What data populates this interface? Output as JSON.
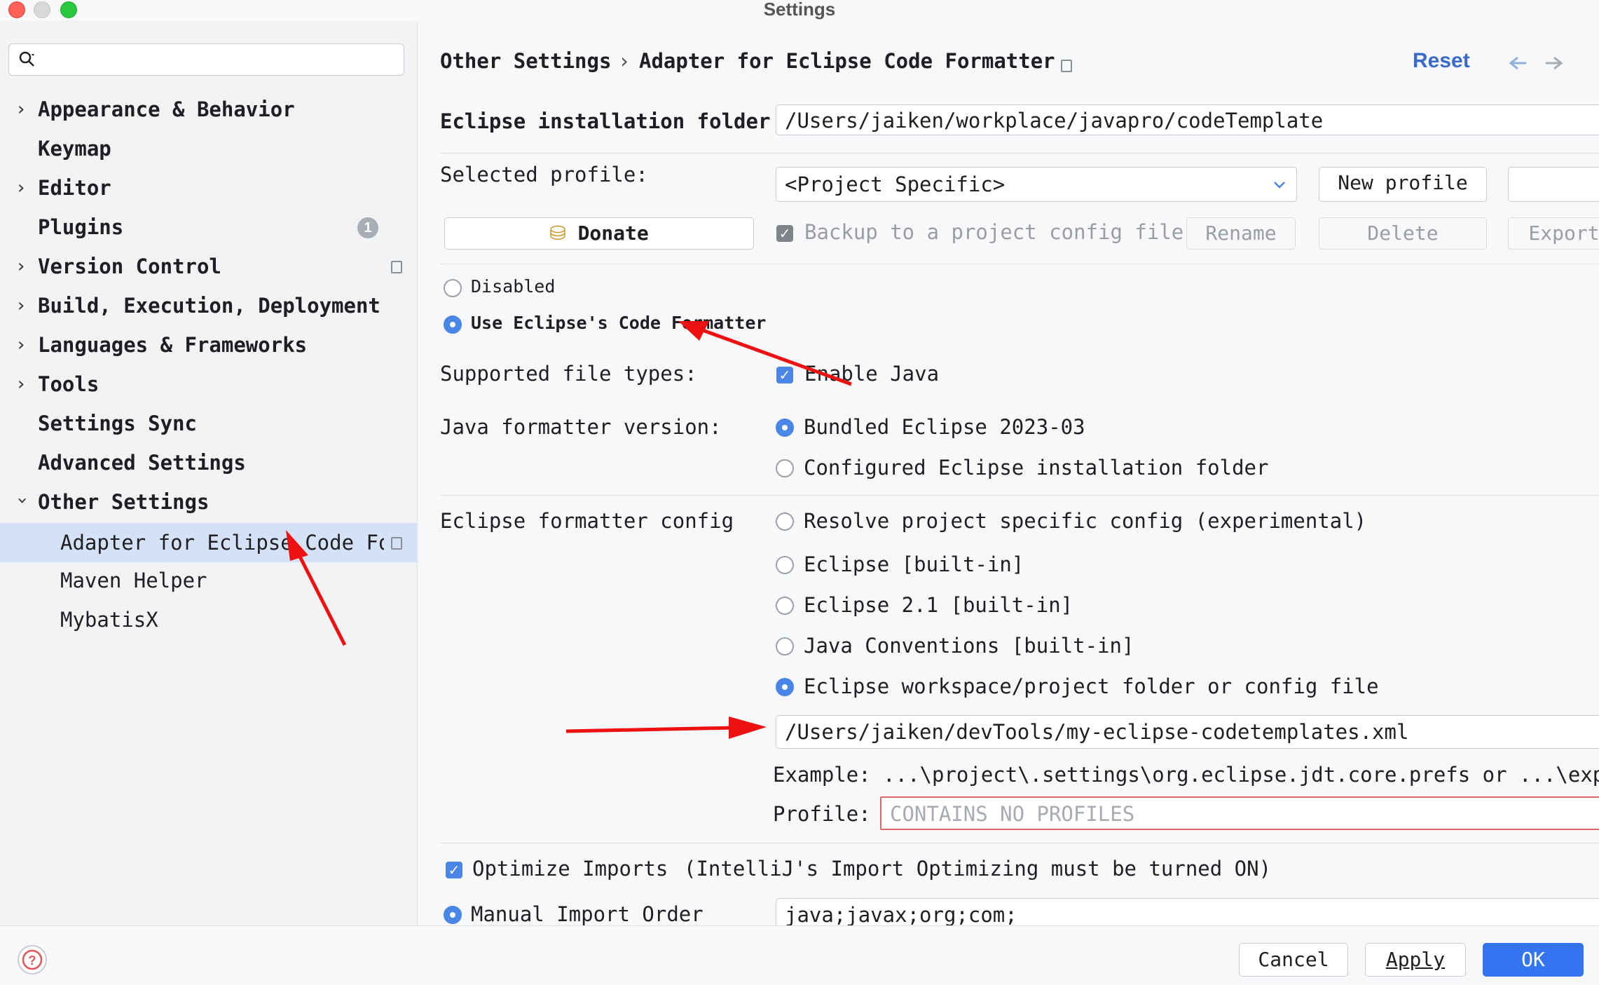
{
  "window": {
    "title": "Settings"
  },
  "sidebar": {
    "search_placeholder": "",
    "items": [
      {
        "label": "Appearance & Behavior",
        "expandable": true
      },
      {
        "label": "Keymap",
        "expandable": false
      },
      {
        "label": "Editor",
        "expandable": true
      },
      {
        "label": "Plugins",
        "expandable": false,
        "badge": "1"
      },
      {
        "label": "Version Control",
        "expandable": true
      },
      {
        "label": "Build, Execution, Deployment",
        "expandable": true
      },
      {
        "label": "Languages & Frameworks",
        "expandable": true
      },
      {
        "label": "Tools",
        "expandable": true
      },
      {
        "label": "Settings Sync",
        "expandable": false
      },
      {
        "label": "Advanced Settings",
        "expandable": false
      },
      {
        "label": "Other Settings",
        "expandable": true,
        "expanded": true
      }
    ],
    "subitems": [
      {
        "label": "Adapter for Eclipse Code For",
        "selected": true
      },
      {
        "label": "Maven Helper"
      },
      {
        "label": "MybatisX"
      }
    ]
  },
  "header": {
    "breadcrumb_parent": "Other Settings",
    "breadcrumb_sep": "›",
    "breadcrumb_current": "Adapter for Eclipse Code Formatter",
    "reset": "Reset",
    "back_icon": "arrow-left-icon",
    "forward_icon": "arrow-right-icon"
  },
  "form": {
    "install_folder_label": "Eclipse installation folder",
    "install_folder_value": "/Users/jaiken/workplace/javapro/codeTemplate",
    "profile_label": "Selected profile:",
    "profile_value": "<Project Specific>",
    "new_profile": "New profile",
    "donate": "Donate",
    "backup_label": "Backup to a project config file",
    "rename": "Rename",
    "delete": "Delete",
    "export": "Export",
    "mode_disabled": "Disabled",
    "mode_eclipse": "Use Eclipse's Code Formatter",
    "file_types_label": "Supported file types:",
    "enable_java": "Enable Java",
    "java_version_label": "Java formatter version:",
    "bundled": "Bundled Eclipse 2023-03",
    "configured": "Configured Eclipse installation folder",
    "config_label": "Eclipse formatter config",
    "cfg_resolve": "Resolve project specific config (experimental)",
    "cfg_builtin": "Eclipse [built-in]",
    "cfg_21": "Eclipse 2.1 [built-in]",
    "cfg_javaconv": "Java Conventions [built-in]",
    "cfg_workspace": "Eclipse workspace/project folder or config file",
    "config_path": "/Users/jaiken/devTools/my-eclipse-codetemplates.xml",
    "example_label": "Example:",
    "example_value": "...\\project\\.settings\\org.eclipse.jdt.core.prefs or ...\\export",
    "profile_label2": "Profile:",
    "profile_placeholder": "CONTAINS NO PROFILES",
    "optimize_imports": "Optimize Imports",
    "optimize_note": "(IntelliJ's Import Optimizing must be turned ON)",
    "manual_import": "Manual Import Order",
    "import_order": "java;javax;org;com;"
  },
  "footer": {
    "help_icon": "help-icon",
    "cancel": "Cancel",
    "apply": "Apply",
    "ok": "OK"
  },
  "colors": {
    "accent": "#3574f0",
    "selection": "#d5e1f6",
    "annotation_arrow": "#ee1111",
    "error_border": "#e06666"
  }
}
